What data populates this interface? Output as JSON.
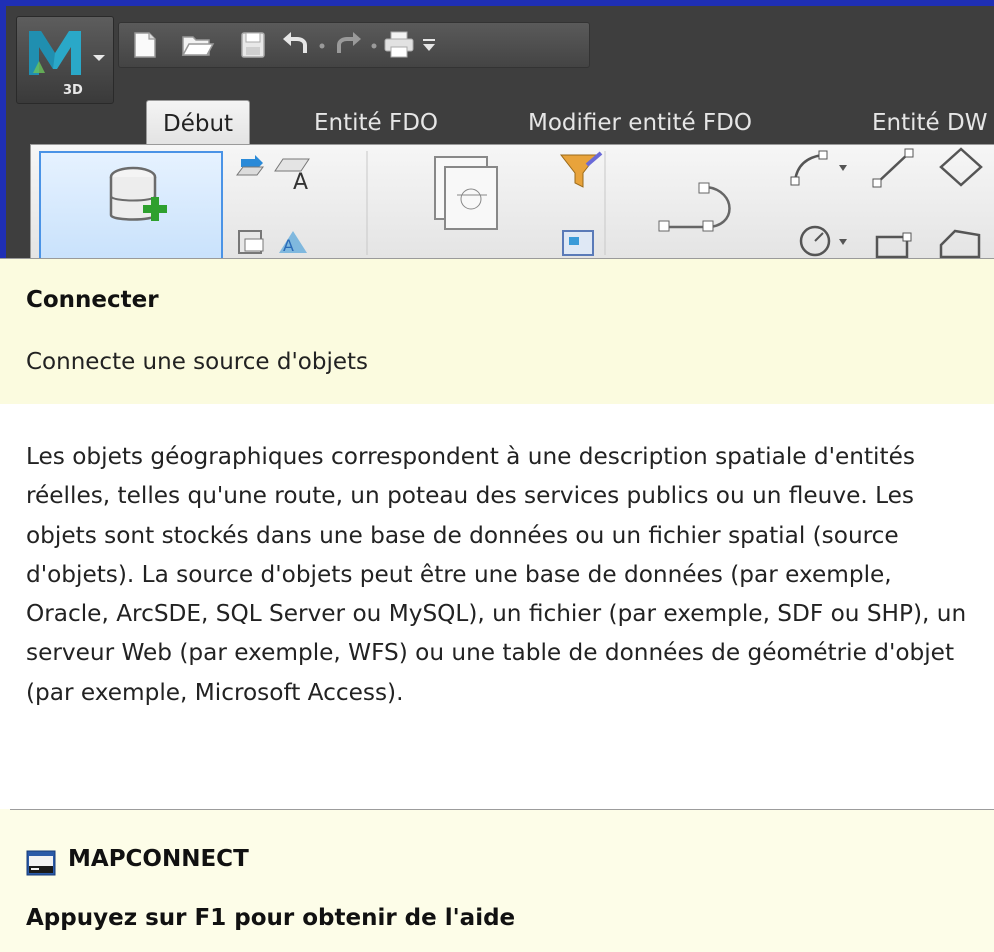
{
  "app": {
    "badge": "3D",
    "logo_letter": "M"
  },
  "quick_access": {
    "icons": [
      "new-icon",
      "open-icon",
      "save-icon",
      "undo-icon",
      "redo-icon",
      "print-icon",
      "customize-dropdown-icon"
    ]
  },
  "ribbon": {
    "tabs": [
      {
        "label": "Début",
        "active": true
      },
      {
        "label": "Entité FDO",
        "active": false
      },
      {
        "label": "Modifier entité FDO",
        "active": false
      },
      {
        "label": "Entité DW",
        "active": false
      }
    ]
  },
  "tooltip": {
    "title": "Connecter",
    "description": "Connecte une source d'objets",
    "extended": "Les objets géographiques correspondent à une description spatiale d'entités réelles, telles qu'une route, un poteau des services publics ou un fleuve. Les objets sont stockés dans une base de données ou un fichier spatial (source d'objets). La source d'objets peut être une base de données (par exemple, Oracle, ArcSDE, SQL Server ou MySQL), un fichier (par exemple, SDF ou SHP), un serveur Web (par exemple, WFS) ou une table de données de géométrie d'objet (par exemple, Microsoft Access).",
    "command": "MAPCONNECT",
    "help": "Appuyez sur F1 pour obtenir de l'aide"
  },
  "colors": {
    "window_frame": "#1f2fb5",
    "ribbon_dark": "#3e3e3e",
    "tooltip_bg": "#fdfde8",
    "selected_button": "#c6e0fb"
  }
}
